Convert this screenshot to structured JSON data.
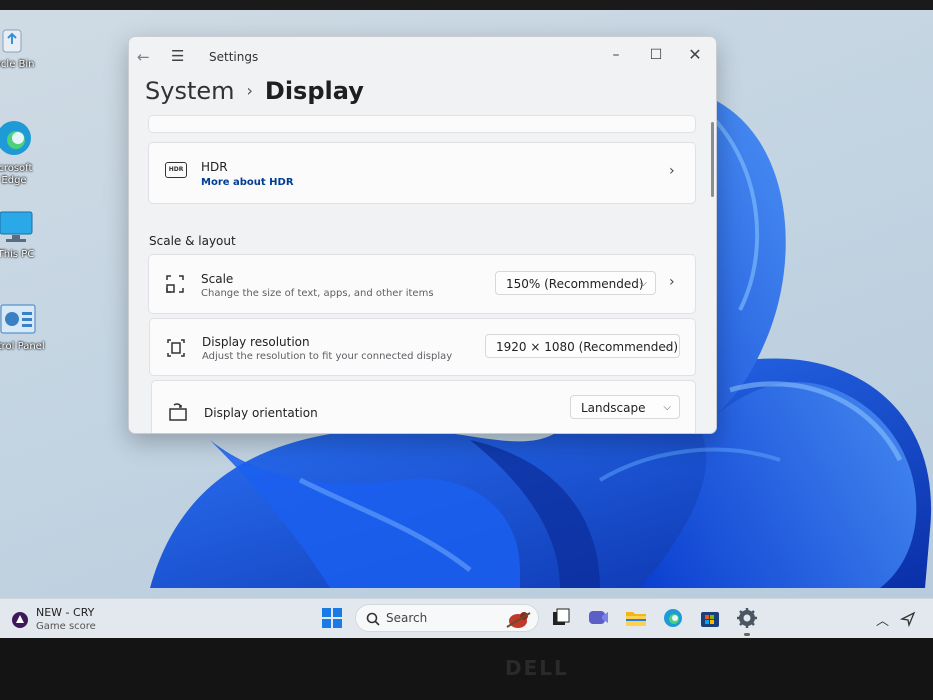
{
  "desktop": {
    "icons": [
      {
        "label": "cycle Bin"
      },
      {
        "label": "icrosoft Edge"
      },
      {
        "label": "This PC"
      },
      {
        "label": "ntrol Panel"
      }
    ]
  },
  "window": {
    "app_title": "Settings",
    "breadcrumb": {
      "parent": "System",
      "separator": "›",
      "current": "Display"
    },
    "hdr": {
      "title": "HDR",
      "link": "More about HDR",
      "icon_text": "HDR"
    },
    "section_title": "Scale & layout",
    "scale": {
      "title": "Scale",
      "subtitle": "Change the size of text, apps, and other items",
      "value": "150% (Recommended)"
    },
    "resolution": {
      "title": "Display resolution",
      "subtitle": "Adjust the resolution to fit your connected display",
      "value": "1920 × 1080 (Recommended)"
    },
    "orientation": {
      "title": "Display orientation",
      "value": "Landscape"
    }
  },
  "taskbar": {
    "widget": {
      "title": "NEW - CRY",
      "subtitle": "Game score"
    },
    "search_label": "Search"
  },
  "device": {
    "brand": "DELL"
  },
  "colors": {
    "accent": "#0a5bd6",
    "link": "#003e92"
  }
}
